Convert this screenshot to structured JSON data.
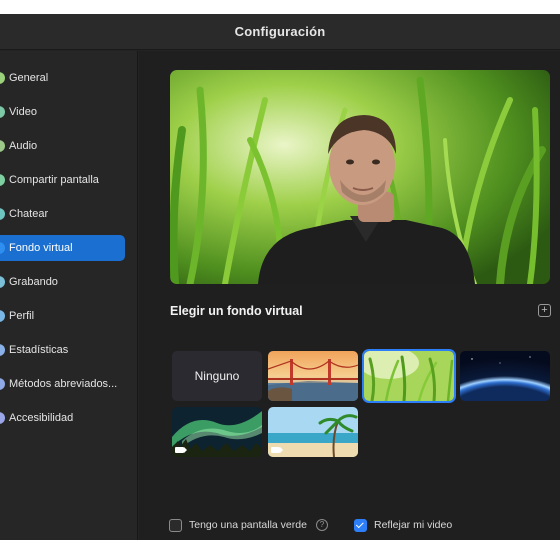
{
  "window": {
    "title": "Configuración"
  },
  "sidebar": {
    "items": [
      {
        "label": "General",
        "icon": "gear-icon",
        "color": "#9ad17a"
      },
      {
        "label": "Video",
        "icon": "video-camera-icon",
        "color": "#7ec8a8"
      },
      {
        "label": "Audio",
        "icon": "headphones-icon",
        "color": "#9cc98a"
      },
      {
        "label": "Compartir pantalla",
        "icon": "share-screen-icon",
        "color": "#7ed0a0"
      },
      {
        "label": "Chatear",
        "icon": "chat-bubble-icon",
        "color": "#6fc6c0"
      },
      {
        "label": "Fondo virtual",
        "icon": "person-background-icon",
        "color": "#2f8ff0",
        "active": true
      },
      {
        "label": "Grabando",
        "icon": "record-icon",
        "color": "#7cc0d8"
      },
      {
        "label": "Perfil",
        "icon": "profile-icon",
        "color": "#79b7e6"
      },
      {
        "label": "Estadísticas",
        "icon": "statistics-icon",
        "color": "#8ab0e8"
      },
      {
        "label": "Métodos abreviados...",
        "icon": "keyboard-icon",
        "color": "#8fa8e6"
      },
      {
        "label": "Accesibilidad",
        "icon": "accessibility-icon",
        "color": "#9aa6e8"
      }
    ]
  },
  "main": {
    "section_title": "Elegir un fondo virtual",
    "add_icon": "plus-square-icon",
    "thumbnails": [
      {
        "label": "Ninguno",
        "kind": "none"
      },
      {
        "kind": "golden-gate-bridge"
      },
      {
        "kind": "grass",
        "selected": true
      },
      {
        "kind": "earth-from-space"
      },
      {
        "kind": "aurora",
        "video": true
      },
      {
        "kind": "beach",
        "video": true
      }
    ],
    "green_screen": {
      "label": "Tengo una pantalla verde",
      "checked": false,
      "help_icon": "question-circle-icon",
      "help_glyph": "?"
    },
    "mirror": {
      "label": "Reflejar mi video",
      "checked": true
    }
  },
  "colors": {
    "accent": "#1b6fd0",
    "window_bg": "#232323",
    "checkbox_checked": "#2d7ff9"
  }
}
